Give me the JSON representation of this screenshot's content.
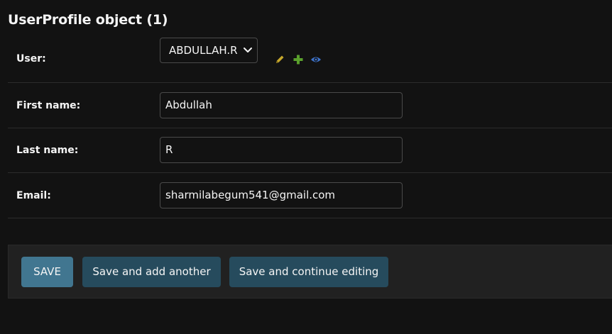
{
  "title": "UserProfile object (1)",
  "fields": {
    "user": {
      "label": "User:",
      "selected": "ABDULLAH.R",
      "actions": {
        "change": "pencil-icon",
        "add": "plus-icon",
        "view": "eye-icon"
      }
    },
    "first_name": {
      "label": "First name:",
      "value": "Abdullah"
    },
    "last_name": {
      "label": "Last name:",
      "value": "R"
    },
    "email": {
      "label": "Email:",
      "value": "sharmilabegum541@gmail.com"
    }
  },
  "buttons": {
    "save": "SAVE",
    "save_add_another": "Save and add another",
    "save_continue": "Save and continue editing"
  },
  "colors": {
    "background": "#121212",
    "submit_row": "#212121",
    "primary_button": "#417690",
    "secondary_button": "#264b5d",
    "pencil": "#c8a92c",
    "plus": "#5aa02c",
    "eye": "#3d72c9"
  }
}
